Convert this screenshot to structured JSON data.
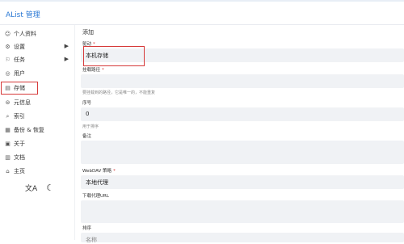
{
  "app_title": "AList 管理",
  "sidebar": {
    "items": [
      {
        "icon": "person-icon",
        "glyph": "☺",
        "label": "个人资料"
      },
      {
        "icon": "gear-icon",
        "glyph": "⚙",
        "label": "设置",
        "has_children": true
      },
      {
        "icon": "tasks-icon",
        "glyph": "⚐",
        "label": "任务",
        "has_children": true
      },
      {
        "icon": "users-icon",
        "glyph": "◎",
        "label": "用户"
      },
      {
        "icon": "storage-icon",
        "glyph": "▤",
        "label": "存储"
      },
      {
        "icon": "meta-icon",
        "glyph": "⊜",
        "label": "元信息"
      },
      {
        "icon": "search-icon",
        "glyph": "⌕",
        "label": "索引"
      },
      {
        "icon": "backup-icon",
        "glyph": "▦",
        "label": "备份 & 恢复"
      },
      {
        "icon": "about-icon",
        "glyph": "▣",
        "label": "关于"
      },
      {
        "icon": "docs-icon",
        "glyph": "▥",
        "label": "文档"
      },
      {
        "icon": "home-icon",
        "glyph": "⌂",
        "label": "主页"
      }
    ],
    "translate_glyph": "文A",
    "moon_glyph": "☾"
  },
  "form": {
    "title": "添加",
    "driver_label": "驱动",
    "driver_value": "本机存储",
    "mount_path_label": "挂载路径",
    "mount_path_help": "要挂载到的路径，它是唯一的，不能重复",
    "order_label": "序号",
    "order_value": "0",
    "order_help": "用于排序",
    "remark_label": "备注",
    "webdav_label": "WebDAV 策略",
    "webdav_value": "本地代理",
    "download_proxy_label": "下载代理URL",
    "sort_label": "排序",
    "sort_value": "名称"
  }
}
